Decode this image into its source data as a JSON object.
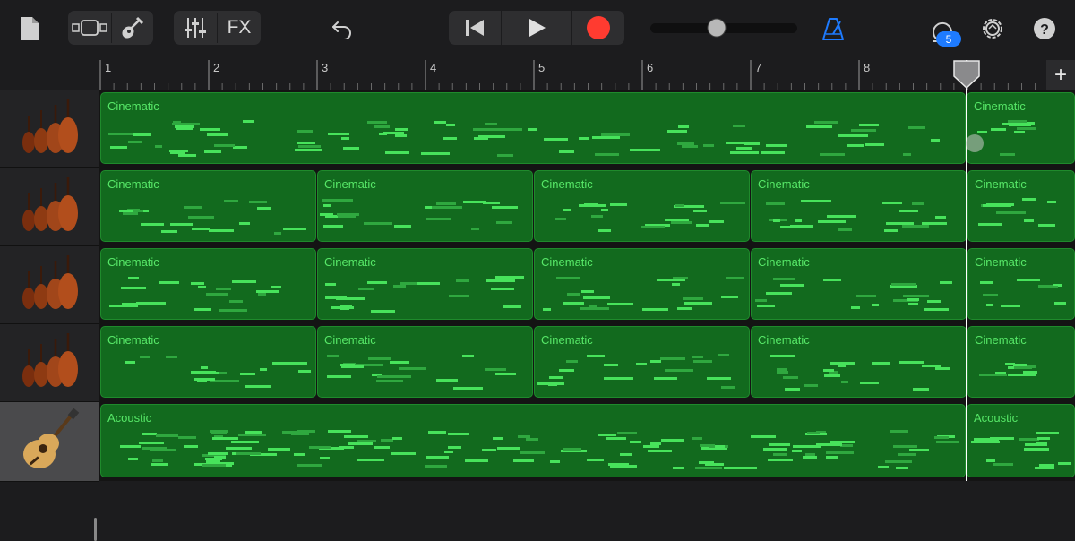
{
  "toolbar": {
    "fx_label": "FX",
    "loop_badge": "5",
    "tempo_slider_value": 0.45,
    "colors": {
      "record": "#ff3b30",
      "metronome": "#1e7bff",
      "badge": "#1e7bff"
    },
    "icons": [
      "document-icon",
      "view-toggle-icon",
      "instrument-guitar-icon",
      "mixer-icon",
      "undo-icon",
      "rewind-icon",
      "play-icon",
      "record-icon",
      "metronome-icon",
      "loop-browser-icon",
      "settings-icon",
      "help-icon"
    ]
  },
  "ruler": {
    "bars": [
      "1",
      "2",
      "3",
      "4",
      "5",
      "6",
      "7",
      "8",
      "9"
    ],
    "add_label": "+"
  },
  "tracks": [
    {
      "instrument": "strings-icon",
      "regions": [
        "Cinematic",
        "Cinematic"
      ]
    },
    {
      "instrument": "strings-icon",
      "regions": [
        "Cinematic",
        "Cinematic",
        "Cinematic",
        "Cinematic",
        "Cinematic"
      ]
    },
    {
      "instrument": "strings-icon",
      "regions": [
        "Cinematic",
        "Cinematic",
        "Cinematic",
        "Cinematic",
        "Cinematic"
      ]
    },
    {
      "instrument": "strings-icon",
      "regions": [
        "Cinematic",
        "Cinematic",
        "Cinematic",
        "Cinematic",
        "Cinematic"
      ]
    },
    {
      "instrument": "acoustic-guitar-icon",
      "regions": [
        "Acoustic",
        "Acoustic"
      ]
    }
  ],
  "playhead_bar": 9
}
